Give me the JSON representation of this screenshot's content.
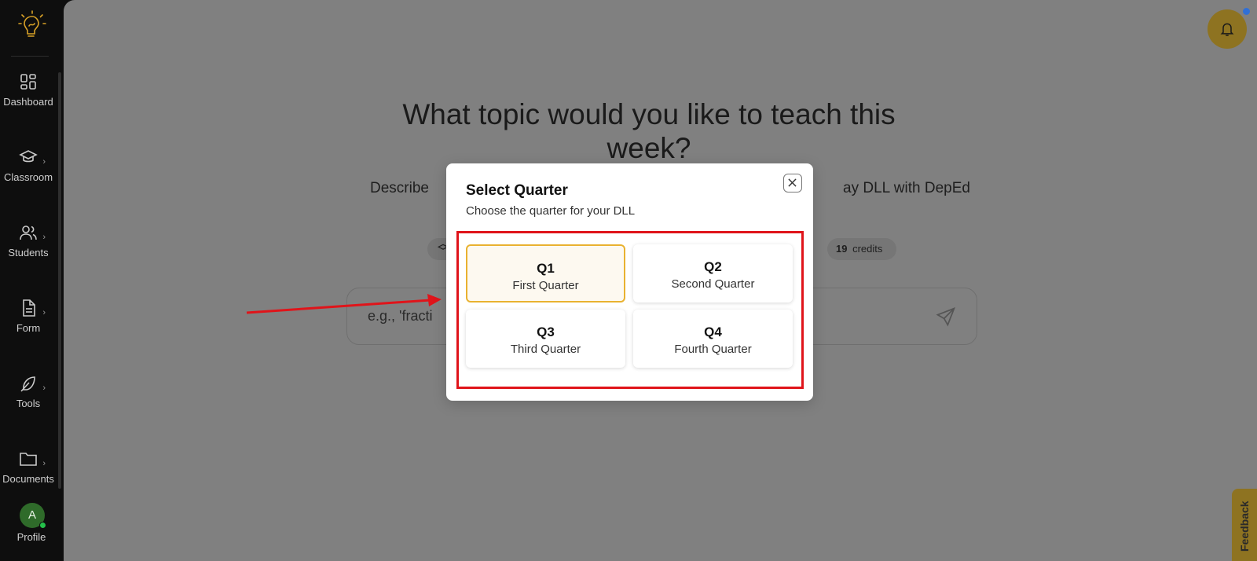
{
  "sidebar": {
    "items": [
      {
        "label": "Dashboard",
        "icon": "dashboard-grid-icon"
      },
      {
        "label": "Classroom",
        "icon": "graduation-cap-icon"
      },
      {
        "label": "Students",
        "icon": "users-icon"
      },
      {
        "label": "Form",
        "icon": "document-icon"
      },
      {
        "label": "Tools",
        "icon": "feather-icon"
      },
      {
        "label": "Documents",
        "icon": "folder-icon"
      }
    ],
    "profile": {
      "initial": "A",
      "label": "Profile"
    }
  },
  "main": {
    "headline": "What topic would you like to teach this week?",
    "subline_start": "Describe",
    "subline_end": "ay DLL with DepEd",
    "credits": {
      "count": "19",
      "label": "credits"
    },
    "prompt_placeholder": "e.g., 'fracti"
  },
  "modal": {
    "title": "Select Quarter",
    "subtitle": "Choose the quarter for your DLL",
    "quarters": [
      {
        "code": "Q1",
        "name": "First Quarter",
        "selected": true
      },
      {
        "code": "Q2",
        "name": "Second Quarter",
        "selected": false
      },
      {
        "code": "Q3",
        "name": "Third Quarter",
        "selected": false
      },
      {
        "code": "Q4",
        "name": "Fourth Quarter",
        "selected": false
      }
    ]
  },
  "feedback_label": "Feedback",
  "colors": {
    "accent_gold": "#e9b230",
    "annotation_red": "#e0141a",
    "sidebar_bg": "#0e0e0e",
    "overlay_bg": "#808080"
  }
}
